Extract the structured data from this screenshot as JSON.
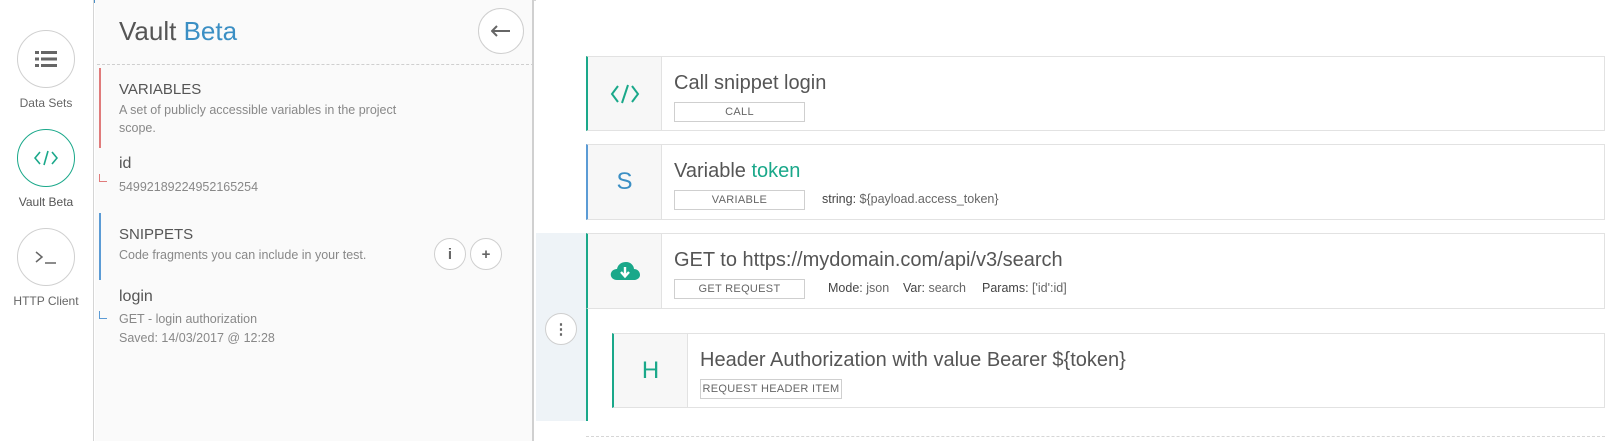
{
  "rail": {
    "items": [
      {
        "label": "Data Sets",
        "icon": "list-icon"
      },
      {
        "label": "Vault Beta",
        "icon": "code-icon"
      },
      {
        "label": "HTTP Client",
        "icon": "terminal-icon"
      }
    ]
  },
  "vault": {
    "title_main": "Vault",
    "title_accent": "Beta",
    "variables": {
      "title": "VARIABLES",
      "description": "A set of publicly accessible variables in the project scope.",
      "entry_name": "id",
      "entry_value": "54992189224952165254"
    },
    "snippets": {
      "title": "SNIPPETS",
      "description": "Code fragments you can include in your test.",
      "entry_name": "login",
      "entry_desc": "GET - login authorization",
      "entry_saved": "Saved: 14/03/2017 @ 12:28"
    }
  },
  "steps": {
    "call": {
      "title": "Call snippet login",
      "badge": "CALL"
    },
    "variable": {
      "title_prefix": "Variable",
      "title_highlight": "token",
      "icon_letter": "S",
      "badge": "VARIABLE",
      "meta_key": "string:",
      "meta_value": "${payload.access_token}"
    },
    "get": {
      "title": "GET to https://mydomain.com/api/v3/search",
      "badge": "GET REQUEST",
      "mode_key": "Mode:",
      "mode_value": "json",
      "var_key": "Var:",
      "var_value": "search",
      "params_key": "Params:",
      "params_value": "['id':id]"
    },
    "header": {
      "icon_letter": "H",
      "title": "Header Authorization with value Bearer ${token}",
      "badge": "REQUEST HEADER ITEM"
    }
  },
  "colors": {
    "accent_teal": "#1aa88a",
    "accent_blue": "#3b8fc4",
    "variables_bar": "#e07b7b",
    "snippets_bar": "#5b9bd5"
  }
}
